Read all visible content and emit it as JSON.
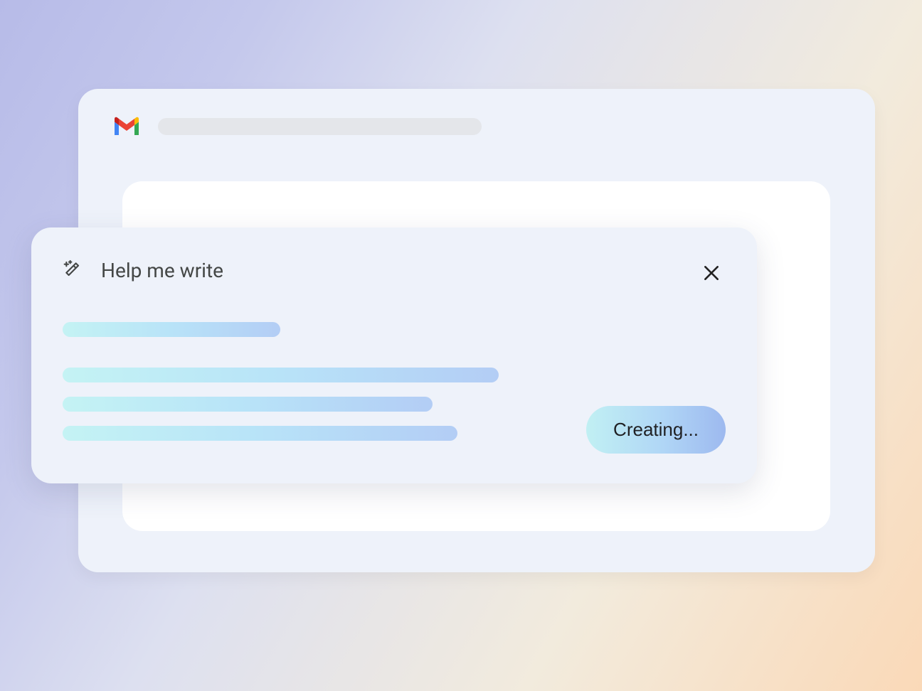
{
  "panel": {
    "title": "Help me write",
    "status_button": "Creating..."
  }
}
